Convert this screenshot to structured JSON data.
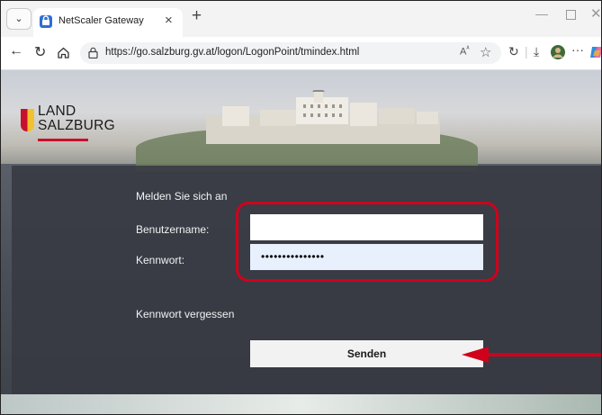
{
  "browser": {
    "tab_title": "NetScaler Gateway",
    "url": "https://go.salzburg.gv.at/logon/LogonPoint/tmindex.html"
  },
  "logo": {
    "line1": "LAND",
    "line2": "SALZBURG"
  },
  "login": {
    "heading": "Melden Sie sich an",
    "username_label": "Benutzername:",
    "username_value": "",
    "password_label": "Kennwort:",
    "password_value": "•••••••••••••••",
    "forgot_link": "Kennwort vergessen",
    "submit_label": "Senden"
  },
  "colors": {
    "highlight": "#d0021b",
    "brand_red": "#c8102e"
  }
}
